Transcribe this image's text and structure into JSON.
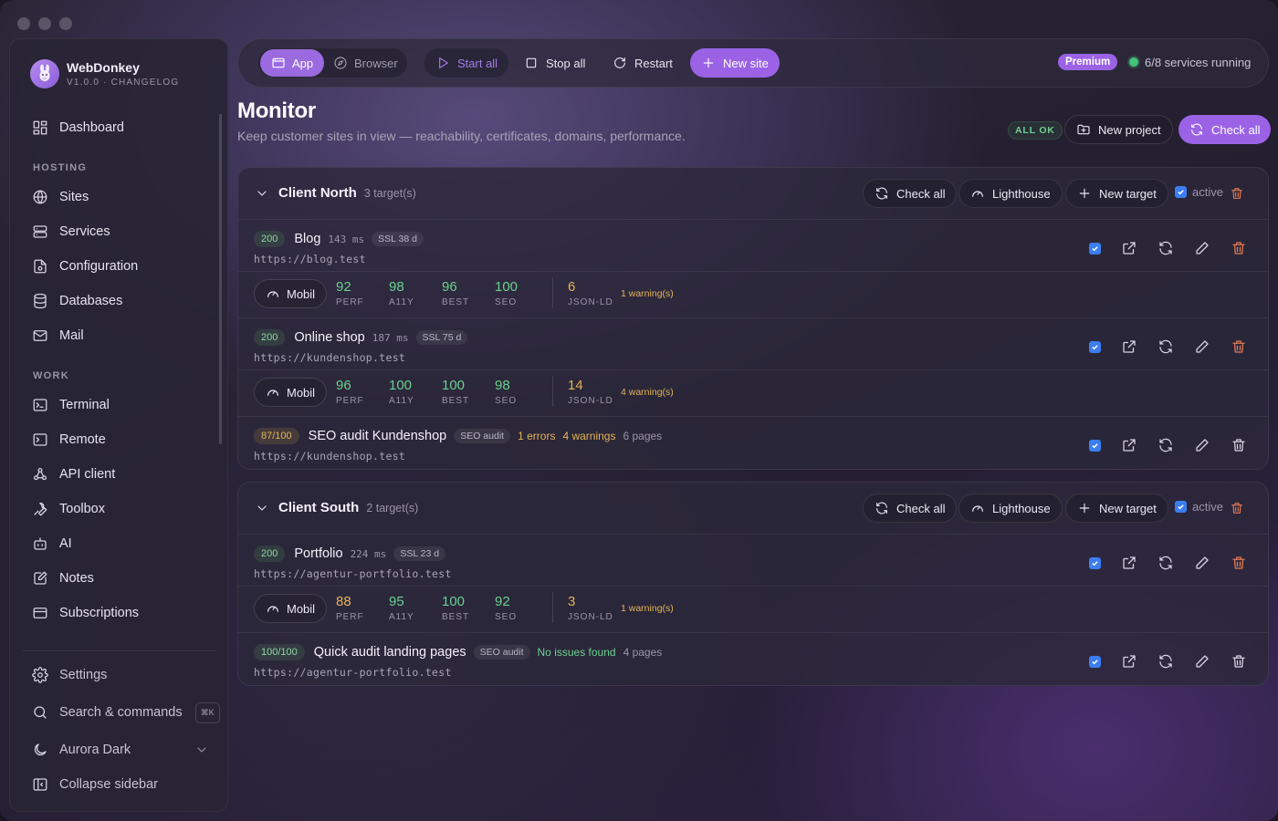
{
  "window": {
    "title": "WebDonkey"
  },
  "brand": {
    "name": "WebDonkey",
    "version": "V1.0.0 · CHANGELOG"
  },
  "sidebar": {
    "dashboard": "Dashboard",
    "hosting_label": "HOSTING",
    "hosting": [
      "Sites",
      "Services",
      "Configuration",
      "Databases",
      "Mail"
    ],
    "work_label": "WORK",
    "work": [
      "Terminal",
      "Remote",
      "API client",
      "Toolbox",
      "AI",
      "Notes",
      "Subscriptions"
    ],
    "settings": "Settings",
    "search": "Search & commands",
    "search_kbd": "⌘K",
    "theme": "Aurora Dark",
    "collapse": "Collapse sidebar"
  },
  "toolbar": {
    "app": "App",
    "browser": "Browser",
    "start_all": "Start all",
    "stop_all": "Stop all",
    "restart": "Restart",
    "new_site": "New site",
    "premium": "Premium",
    "services_running": "6/8 services running"
  },
  "page": {
    "title": "Monitor",
    "subtitle": "Keep customer sites in view — reachability, certificates, domains, performance.",
    "status": "ALL OK",
    "new_project": "New project",
    "check_all": "Check all"
  },
  "labels": {
    "check_all": "Check all",
    "lighthouse": "Lighthouse",
    "new_target": "New target",
    "active": "active",
    "mobil": "Mobil",
    "perf": "PERF",
    "a11y": "A11Y",
    "best": "BEST",
    "seo": "SEO",
    "jsonld": "JSON-LD"
  },
  "groups": [
    {
      "name": "Client North",
      "count": "3 target(s)",
      "targets": [
        {
          "code": "200",
          "name": "Blog",
          "ms": "143 ms",
          "ssl": "SSL 38 d",
          "url": "https://blog.test",
          "scores": {
            "perf": "92",
            "a11y": "98",
            "best": "96",
            "seo": "100",
            "jsonld": "6"
          },
          "warnings": "1 warning(s)"
        },
        {
          "code": "200",
          "name": "Online shop",
          "ms": "187 ms",
          "ssl": "SSL 75 d",
          "url": "https://kundenshop.test",
          "scores": {
            "perf": "96",
            "a11y": "100",
            "best": "100",
            "seo": "98",
            "jsonld": "14"
          },
          "warnings": "4 warning(s)"
        },
        {
          "code": "87/100",
          "name": "SEO audit Kundenshop",
          "tag": "SEO audit",
          "errors": "1 errors",
          "warnings": "4 warnings",
          "pages": "6 pages",
          "url": "https://kundenshop.test"
        }
      ]
    },
    {
      "name": "Client South",
      "count": "2 target(s)",
      "targets": [
        {
          "code": "200",
          "name": "Portfolio",
          "ms": "224 ms",
          "ssl": "SSL 23 d",
          "url": "https://agentur-portfolio.test",
          "scores": {
            "perf": "88",
            "a11y": "95",
            "best": "100",
            "seo": "92",
            "jsonld": "3"
          },
          "warnings": "1 warning(s)"
        },
        {
          "code": "100/100",
          "name": "Quick audit landing pages",
          "tag": "SEO audit",
          "status": "No issues found",
          "pages": "4 pages",
          "url": "https://agentur-portfolio.test"
        }
      ]
    }
  ],
  "colors": {
    "accent": "#9b62e6",
    "ok": "#6ad08e",
    "warn": "#e3b356",
    "danger": "#e57a52",
    "checkbox": "#3b7ef0"
  }
}
